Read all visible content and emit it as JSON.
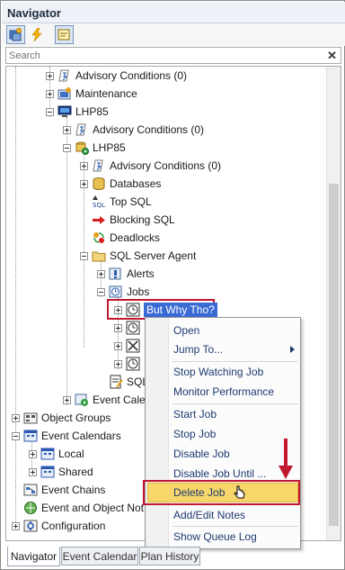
{
  "panel": {
    "title": "Navigator"
  },
  "toolbar": {
    "buttons": [
      "add-object-icon",
      "lightning-icon",
      "notes-icon"
    ]
  },
  "search": {
    "placeholder": "Search",
    "clear": "✕"
  },
  "tree": {
    "advisory1": "Advisory Conditions (0)",
    "maintenance": "Maintenance",
    "lhp85": "LHP85",
    "advisory2": "Advisory Conditions (0)",
    "lhp85_instance": "LHP85",
    "advisory3": "Advisory Conditions (0)",
    "databases": "Databases",
    "top_sql": "Top SQL",
    "blocking_sql": "Blocking SQL",
    "deadlocks": "Deadlocks",
    "sql_server_agent": "SQL Server Agent",
    "alerts": "Alerts",
    "jobs": "Jobs",
    "selected_job": "But Why Tho?",
    "sql_partial": "SQL",
    "event_calendar_partial": "Event Cale",
    "object_groups": "Object Groups",
    "event_calendars": "Event Calendars",
    "local": "Local",
    "shared": "Shared",
    "event_chains": "Event Chains",
    "event_object_notes": "Event and Object Not",
    "configuration": "Configuration"
  },
  "context_menu": {
    "open": "Open",
    "jump_to": "Jump To...",
    "stop_watching_job": "Stop Watching Job",
    "monitor_performance": "Monitor Performance",
    "start_job": "Start Job",
    "stop_job": "Stop Job",
    "disable_job": "Disable Job",
    "disable_job_until": "Disable Job Until ...",
    "delete_job": "Delete Job",
    "add_edit_notes": "Add/Edit Notes",
    "show_queue_log": "Show Queue Log"
  },
  "tabs": [
    "Navigator",
    "Event Calendar",
    "Plan History"
  ],
  "colors": {
    "selection": "#3a6bd4",
    "highlight_box": "#c0182f",
    "menu_hover": "#f7d66a",
    "annotation_arrow": "#c0182f"
  }
}
